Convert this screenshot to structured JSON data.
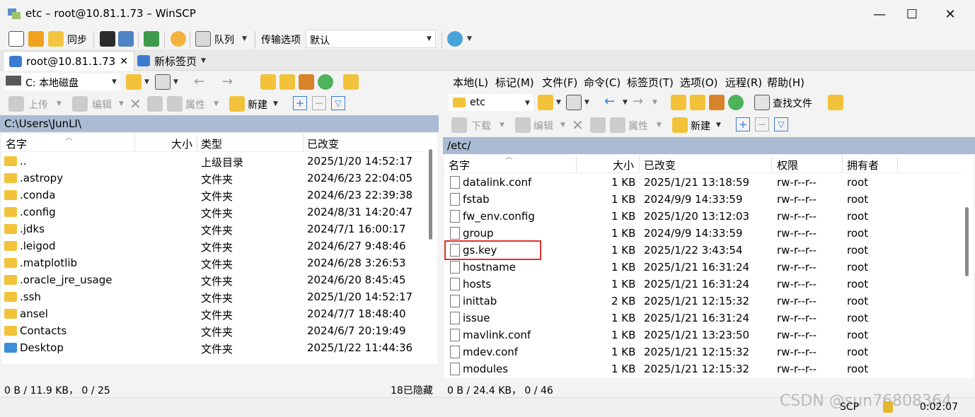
{
  "window": {
    "title": "etc – root@10.81.1.73 – WinSCP",
    "minimize": "—",
    "maximize": "☐",
    "close": "✕"
  },
  "toolbar": {
    "sync_label": "同步",
    "queue_label": "队列",
    "transfer_options_label": "传输选项",
    "transfer_options_value": "默认"
  },
  "tabs": [
    {
      "label": "root@10.81.1.73",
      "close": "✕"
    },
    {
      "label": "新标签页"
    }
  ],
  "left": {
    "drive": "C: 本地磁盘",
    "upload": "上传",
    "edit": "编辑",
    "properties": "属性",
    "new": "新建",
    "path": "C:\\Users\\JunLI\\",
    "columns": {
      "name": "名字",
      "size": "大小",
      "type": "类型",
      "modified": "已改变"
    },
    "rows": [
      {
        "name": "..",
        "type": "上级目录",
        "modified": "2025/1/20 14:52:17"
      },
      {
        "name": ".astropy",
        "type": "文件夹",
        "modified": "2024/6/23 22:04:05"
      },
      {
        "name": ".conda",
        "type": "文件夹",
        "modified": "2024/6/23 22:39:38"
      },
      {
        "name": ".config",
        "type": "文件夹",
        "modified": "2024/8/31 14:20:47"
      },
      {
        "name": ".jdks",
        "type": "文件夹",
        "modified": "2024/7/1 16:00:17"
      },
      {
        "name": ".leigod",
        "type": "文件夹",
        "modified": "2024/6/27 9:48:46"
      },
      {
        "name": ".matplotlib",
        "type": "文件夹",
        "modified": "2024/6/28 3:26:53"
      },
      {
        "name": ".oracle_jre_usage",
        "type": "文件夹",
        "modified": "2024/6/20 8:45:45"
      },
      {
        "name": ".ssh",
        "type": "文件夹",
        "modified": "2025/1/20 14:52:17"
      },
      {
        "name": "ansel",
        "type": "文件夹",
        "modified": "2024/7/7 18:48:40"
      },
      {
        "name": "Contacts",
        "type": "文件夹",
        "modified": "2024/6/7 20:19:49"
      },
      {
        "name": "Desktop",
        "type": "文件夹",
        "modified": "2025/1/22 11:44:36"
      }
    ],
    "status_left": "0 B / 11.9 KB，  0 / 25",
    "status_right": "18已隐藏"
  },
  "right": {
    "menu": [
      "本地(L)",
      "标记(M)",
      "文件(F)",
      "命令(C)",
      "标签页(T)",
      "选项(O)",
      "远程(R)",
      "帮助(H)"
    ],
    "dir": "etc",
    "find": "查找文件",
    "download": "下载",
    "edit": "编辑",
    "properties": "属性",
    "new": "新建",
    "path": "/etc/",
    "columns": {
      "name": "名字",
      "size": "大小",
      "modified": "已改变",
      "rights": "权限",
      "owner": "拥有者"
    },
    "rows": [
      {
        "name": "datalink.conf",
        "size": "1 KB",
        "modified": "2025/1/21 13:18:59",
        "rights": "rw-r--r--",
        "owner": "root"
      },
      {
        "name": "fstab",
        "size": "1 KB",
        "modified": "2024/9/9 14:33:59",
        "rights": "rw-r--r--",
        "owner": "root"
      },
      {
        "name": "fw_env.config",
        "size": "1 KB",
        "modified": "2025/1/20 13:12:03",
        "rights": "rw-r--r--",
        "owner": "root"
      },
      {
        "name": "group",
        "size": "1 KB",
        "modified": "2024/9/9 14:33:59",
        "rights": "rw-r--r--",
        "owner": "root"
      },
      {
        "name": "gs.key",
        "size": "1 KB",
        "modified": "2025/1/22 3:43:54",
        "rights": "rw-r--r--",
        "owner": "root"
      },
      {
        "name": "hostname",
        "size": "1 KB",
        "modified": "2025/1/21 16:31:24",
        "rights": "rw-r--r--",
        "owner": "root"
      },
      {
        "name": "hosts",
        "size": "1 KB",
        "modified": "2025/1/21 16:31:24",
        "rights": "rw-r--r--",
        "owner": "root"
      },
      {
        "name": "inittab",
        "size": "2 KB",
        "modified": "2025/1/21 12:15:32",
        "rights": "rw-r--r--",
        "owner": "root"
      },
      {
        "name": "issue",
        "size": "1 KB",
        "modified": "2025/1/21 16:31:24",
        "rights": "rw-r--r--",
        "owner": "root"
      },
      {
        "name": "mavlink.conf",
        "size": "1 KB",
        "modified": "2025/1/21 13:23:50",
        "rights": "rw-r--r--",
        "owner": "root"
      },
      {
        "name": "mdev.conf",
        "size": "1 KB",
        "modified": "2025/1/21 12:15:32",
        "rights": "rw-r--r--",
        "owner": "root"
      },
      {
        "name": "modules",
        "size": "1 KB",
        "modified": "2025/1/21 12:15:32",
        "rights": "rw-r--r--",
        "owner": "root"
      }
    ],
    "status_left": "0 B / 24.4 KB，  0 / 46"
  },
  "statusbar": {
    "protocol": "SCP",
    "elapsed": "0:02:07",
    "watermark": "CSDN @sun76808364"
  },
  "colors": {
    "path_bar": "#a9bcd3",
    "highlight_box": "#e0322d",
    "folder": "#f2c33a"
  }
}
